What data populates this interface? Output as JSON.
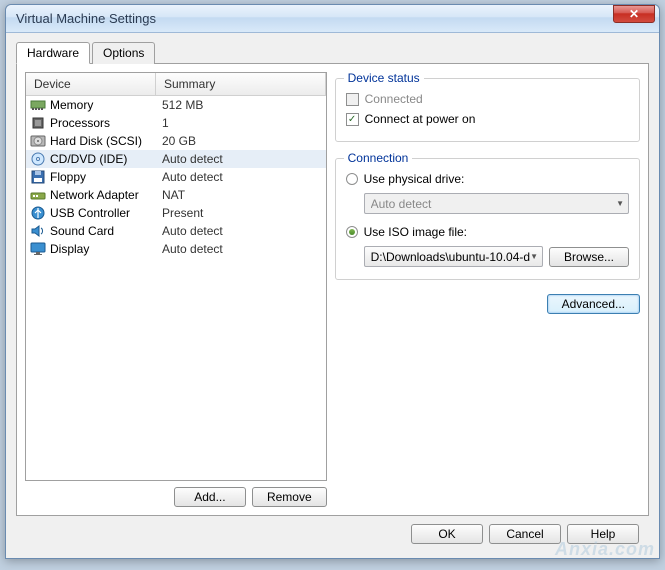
{
  "title": "Virtual Machine Settings",
  "tabs": {
    "hardware": "Hardware",
    "options": "Options"
  },
  "columns": {
    "device": "Device",
    "summary": "Summary"
  },
  "devices": [
    {
      "icon": "memory",
      "name": "Memory",
      "summary": "512 MB",
      "selected": false
    },
    {
      "icon": "cpu",
      "name": "Processors",
      "summary": "1",
      "selected": false
    },
    {
      "icon": "hdd",
      "name": "Hard Disk (SCSI)",
      "summary": "20 GB",
      "selected": false
    },
    {
      "icon": "cd",
      "name": "CD/DVD (IDE)",
      "summary": "Auto detect",
      "selected": true
    },
    {
      "icon": "floppy",
      "name": "Floppy",
      "summary": "Auto detect",
      "selected": false
    },
    {
      "icon": "net",
      "name": "Network Adapter",
      "summary": "NAT",
      "selected": false
    },
    {
      "icon": "usb",
      "name": "USB Controller",
      "summary": "Present",
      "selected": false
    },
    {
      "icon": "sound",
      "name": "Sound Card",
      "summary": "Auto detect",
      "selected": false
    },
    {
      "icon": "display",
      "name": "Display",
      "summary": "Auto detect",
      "selected": false
    }
  ],
  "left_buttons": {
    "add": "Add...",
    "remove": "Remove"
  },
  "status_group": {
    "legend": "Device status",
    "connected": {
      "label": "Connected",
      "checked": false,
      "enabled": false
    },
    "power_on": {
      "label": "Connect at power on",
      "checked": true,
      "enabled": true
    }
  },
  "connection_group": {
    "legend": "Connection",
    "physical": {
      "label": "Use physical drive:",
      "selected": false,
      "combo": "Auto detect"
    },
    "iso": {
      "label": "Use ISO image file:",
      "selected": true,
      "path": "D:\\Downloads\\ubuntu-10.04-d",
      "browse": "Browse..."
    }
  },
  "advanced": "Advanced...",
  "dialog_buttons": {
    "ok": "OK",
    "cancel": "Cancel",
    "help": "Help"
  },
  "watermark": "Anxia.com"
}
